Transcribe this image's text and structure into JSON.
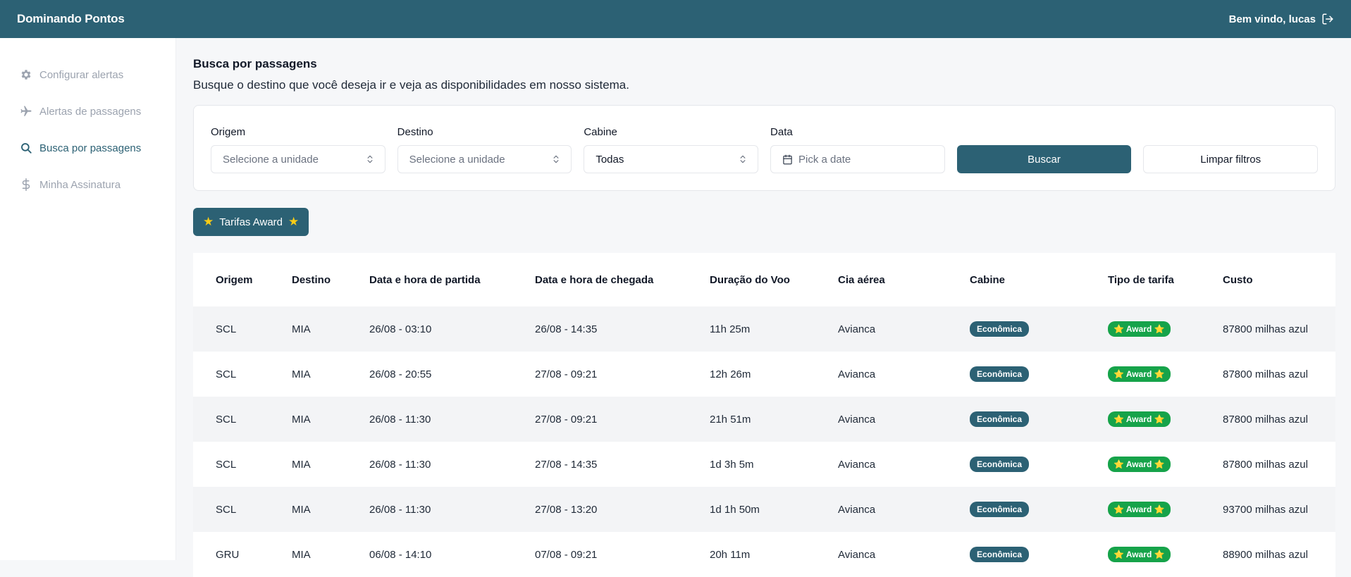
{
  "header": {
    "brand": "Dominando Pontos",
    "welcome": "Bem vindo, lucas"
  },
  "sidebar": {
    "items": [
      {
        "label": "Configurar alertas",
        "icon": "gear-icon"
      },
      {
        "label": "Alertas de passagens",
        "icon": "plane-icon"
      },
      {
        "label": "Busca por passagens",
        "icon": "search-icon",
        "active": true
      },
      {
        "label": "Minha Assinatura",
        "icon": "dollar-icon"
      }
    ]
  },
  "main": {
    "title": "Busca por passagens",
    "subtitle": "Busque o destino que você deseja ir e veja as disponibilidades em nosso sistema."
  },
  "filters": {
    "origem": {
      "label": "Origem",
      "placeholder": "Selecione a unidade"
    },
    "destino": {
      "label": "Destino",
      "placeholder": "Selecione a unidade"
    },
    "cabine": {
      "label": "Cabine",
      "value": "Todas"
    },
    "data": {
      "label": "Data",
      "placeholder": "Pick a date"
    },
    "search_button": "Buscar",
    "clear_button": "Limpar filtros"
  },
  "tab": {
    "label": "Tarifas Award"
  },
  "table": {
    "columns": [
      "Origem",
      "Destino",
      "Data e hora de partida",
      "Data e hora de chegada",
      "Duração do Voo",
      "Cia aérea",
      "Cabine",
      "Tipo de tarifa",
      "Custo"
    ],
    "rows": [
      {
        "origem": "SCL",
        "destino": "MIA",
        "partida": "26/08 - 03:10",
        "chegada": "26/08 - 14:35",
        "duracao": "11h 25m",
        "cia": "Avianca",
        "cabine": "Econômica",
        "tarifa": "⭐ Award ⭐",
        "custo": "87800 milhas azul"
      },
      {
        "origem": "SCL",
        "destino": "MIA",
        "partida": "26/08 - 20:55",
        "chegada": "27/08 - 09:21",
        "duracao": "12h 26m",
        "cia": "Avianca",
        "cabine": "Econômica",
        "tarifa": "⭐ Award ⭐",
        "custo": "87800 milhas azul"
      },
      {
        "origem": "SCL",
        "destino": "MIA",
        "partida": "26/08 - 11:30",
        "chegada": "27/08 - 09:21",
        "duracao": "21h 51m",
        "cia": "Avianca",
        "cabine": "Econômica",
        "tarifa": "⭐ Award ⭐",
        "custo": "87800 milhas azul"
      },
      {
        "origem": "SCL",
        "destino": "MIA",
        "partida": "26/08 - 11:30",
        "chegada": "27/08 - 14:35",
        "duracao": "1d 3h 5m",
        "cia": "Avianca",
        "cabine": "Econômica",
        "tarifa": "⭐ Award ⭐",
        "custo": "87800 milhas azul"
      },
      {
        "origem": "SCL",
        "destino": "MIA",
        "partida": "26/08 - 11:30",
        "chegada": "27/08 - 13:20",
        "duracao": "1d 1h 50m",
        "cia": "Avianca",
        "cabine": "Econômica",
        "tarifa": "⭐ Award ⭐",
        "custo": "93700 milhas azul"
      },
      {
        "origem": "GRU",
        "destino": "MIA",
        "partida": "06/08 - 14:10",
        "chegada": "07/08 - 09:21",
        "duracao": "20h 11m",
        "cia": "Avianca",
        "cabine": "Econômica",
        "tarifa": "⭐ Award ⭐",
        "custo": "88900 milhas azul"
      }
    ]
  },
  "colors": {
    "primary": "#2c6174",
    "award_green": "#16a34a",
    "star": "#facc15"
  }
}
